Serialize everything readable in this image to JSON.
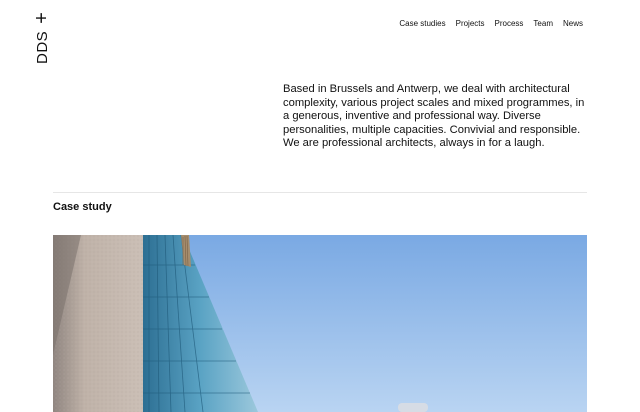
{
  "brand": {
    "name": "DDS",
    "plus": "+"
  },
  "nav": {
    "items": [
      {
        "label": "Case studies"
      },
      {
        "label": "Projects"
      },
      {
        "label": "Process"
      },
      {
        "label": "Team"
      },
      {
        "label": "News"
      }
    ]
  },
  "intro": {
    "text": "Based in Brussels and Antwerp, we deal with architectural complexity, various project scales and mixed programmes, in a generous, inventive and professional way. Diverse personalities, multiple capacities. Convivial and responsible. We are professional architects, always in for a laugh."
  },
  "case_study": {
    "heading": "Case study"
  },
  "colors": {
    "sky": "#7faee6",
    "sky_light": "#b6d2f2",
    "facade": "#b9aca3",
    "glass": "#3d86a8"
  }
}
